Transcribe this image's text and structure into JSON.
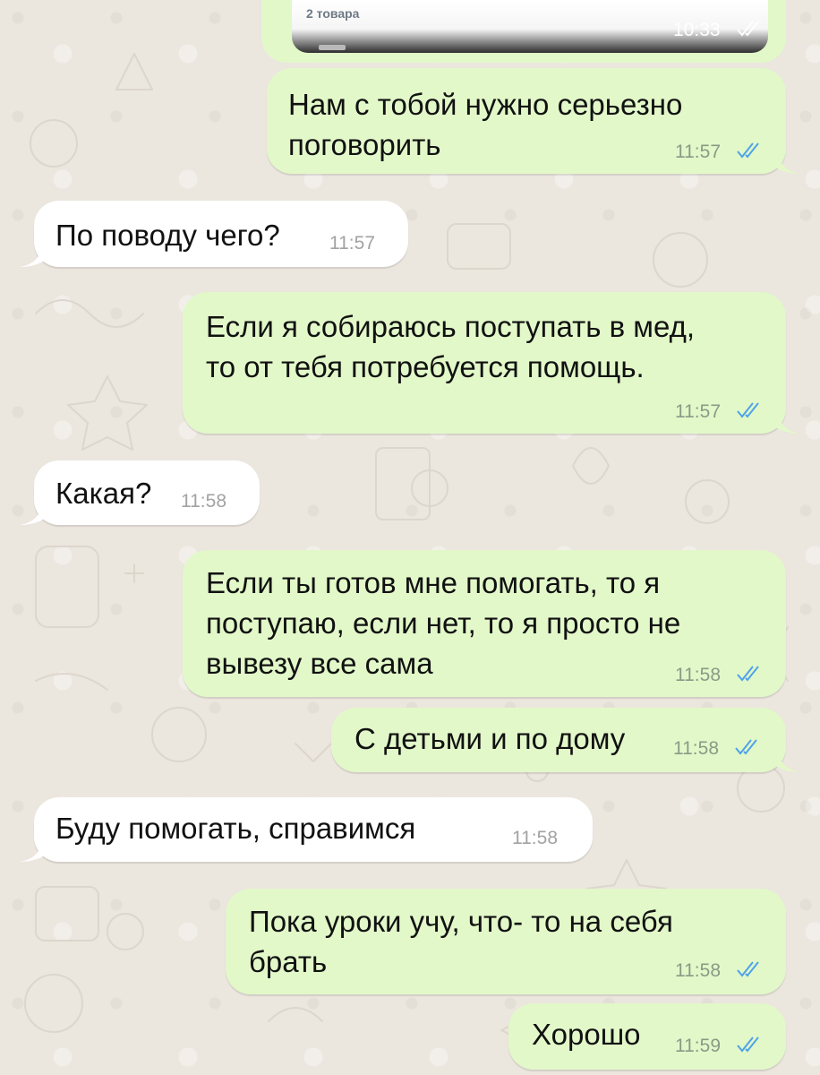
{
  "preview": {
    "card_label": "2 товара",
    "time": "10:33"
  },
  "messages": [
    {
      "id": "m1",
      "direction": "out",
      "text": "Нам с тобой нужно серьезно\nпоговорить",
      "time": "11:57",
      "read": true
    },
    {
      "id": "m2",
      "direction": "in",
      "text": "По поводу чего?",
      "time": "11:57"
    },
    {
      "id": "m3",
      "direction": "out",
      "text": "Если я собираюсь поступать в мед,\nто от тебя потребуется помощь.",
      "time": "11:57",
      "read": true
    },
    {
      "id": "m4",
      "direction": "in",
      "text": "Какая?",
      "time": "11:58"
    },
    {
      "id": "m5",
      "direction": "out",
      "text": "Если ты готов мне помогать, то я\nпоступаю, если нет, то я просто не\nвывезу все сама",
      "time": "11:58",
      "read": true
    },
    {
      "id": "m6",
      "direction": "out",
      "text": "С детьми и по дому",
      "time": "11:58",
      "read": true
    },
    {
      "id": "m7",
      "direction": "in",
      "text": "Буду помогать, справимся",
      "time": "11:58"
    },
    {
      "id": "m8",
      "direction": "out",
      "text": "Пока уроки учу, что- то на себя\nбрать",
      "time": "11:58",
      "read": true
    },
    {
      "id": "m9",
      "direction": "out",
      "text": "Хорошо",
      "time": "11:59",
      "read": true
    }
  ],
  "colors": {
    "outgoing_bubble": "#e2f8c9",
    "incoming_bubble": "#ffffff",
    "read_ticks": "#4fa3e8",
    "background": "#ebe6de"
  },
  "icons": {
    "read_receipt": "double-check-icon"
  }
}
